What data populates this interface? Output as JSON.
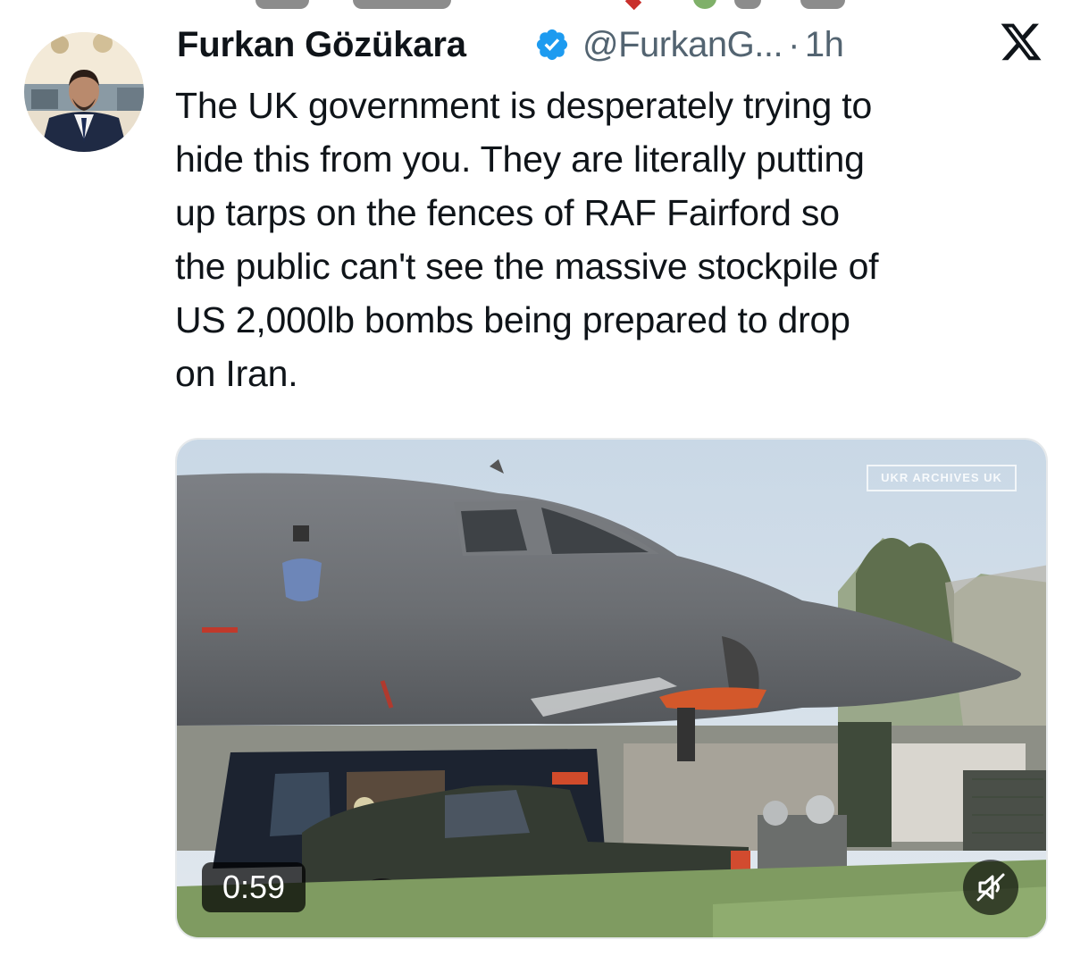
{
  "post": {
    "author_name": "Furkan Gözükara",
    "handle": "@FurkanG...",
    "separator": "·",
    "time": "1h",
    "text": "The UK government is desperately trying to\nhide this from you. They are literally putting\nup tarps on the fences of RAF Fairford so\nthe public can't see the massive stockpile of\nUS 2,000lb bombs being prepared to drop\non Iran."
  },
  "media": {
    "duration": "0:59",
    "watermark": "UKR ARCHIVES UK"
  },
  "icons": {
    "verified": "verified-badge-icon",
    "platform": "x-logo-icon",
    "mute": "speaker-muted-icon"
  },
  "colors": {
    "verified_blue": "#1d9bf0",
    "text": "#0f1419",
    "secondary_text": "#536471"
  }
}
